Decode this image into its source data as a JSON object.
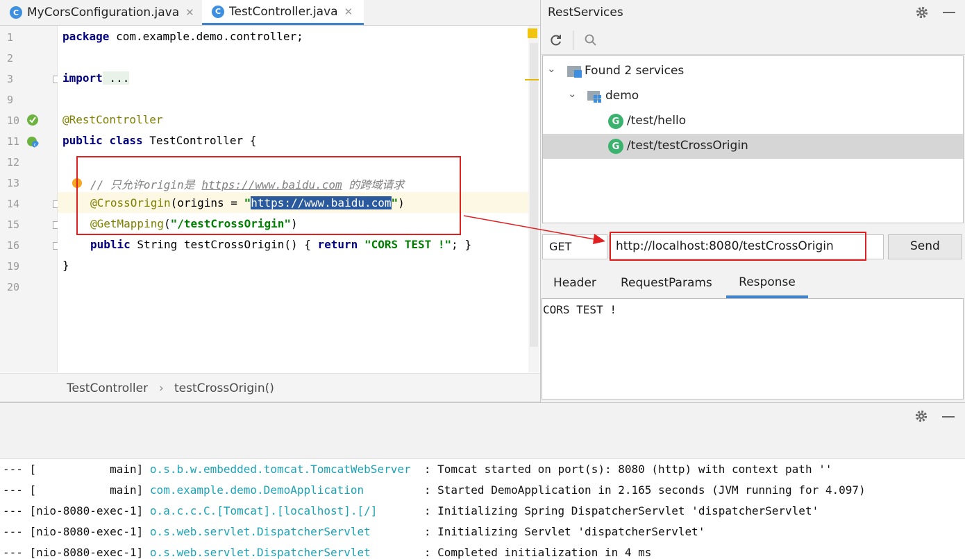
{
  "tabs": [
    {
      "label": "MyCorsConfiguration.java",
      "icon": "class-icon"
    },
    {
      "label": "TestController.java",
      "icon": "class-icon",
      "active": true
    }
  ],
  "editor": {
    "line_numbers": [
      "1",
      "2",
      "3",
      "9",
      "10",
      "11",
      "12",
      "13",
      "14",
      "15",
      "16",
      "19",
      "20"
    ],
    "lines": {
      "l1_kw": "package",
      "l1_rest": " com.example.demo.controller;",
      "l3_kw": "import",
      "l3_rest": " ...",
      "l10": "@RestController",
      "l11_kw1": "public",
      "l11_kw2": "class",
      "l11_rest": " TestController {",
      "l13_comment_a": "// 只允许origin是 ",
      "l13_link": "https://www.baidu.com",
      "l13_comment_b": " 的跨域请求",
      "l14_ann": "@CrossOrigin",
      "l14_a": "(origins = ",
      "l14_q1": "\"",
      "l14_sel": "https://www.baidu.com",
      "l14_q2": "\"",
      "l14_b": ")",
      "l15_ann": "@GetMapping",
      "l15_a": "(",
      "l15_str": "\"/testCrossOrigin\"",
      "l15_b": ")",
      "l16_kw": "public",
      "l16_a": " String testCrossOrigin() { ",
      "l16_kw2": "return",
      "l16_str": " \"CORS TEST !\"",
      "l16_b": "; }",
      "l19": "}"
    }
  },
  "breadcrumb": {
    "class": "TestController",
    "separator": "›",
    "method": "testCrossOrigin()"
  },
  "rest_panel": {
    "title": "RestServices",
    "tree": {
      "root": "Found 2 services",
      "module": "demo",
      "endpoints": [
        "/test/hello",
        "/test/testCrossOrigin"
      ],
      "method_badge": "G"
    },
    "request": {
      "method": "GET",
      "url": "http://localhost:8080/testCrossOrigin",
      "send_label": "Send"
    },
    "subtabs": [
      "Header",
      "RequestParams",
      "Response"
    ],
    "active_subtab": "Response",
    "response_body": "CORS TEST !"
  },
  "console": {
    "lines": [
      {
        "prefix": "--- [           main] ",
        "logger": "o.s.b.w.embedded.tomcat.TomcatWebServer ",
        "msg": " : Tomcat started on port(s): 8080 (http) with context path ''"
      },
      {
        "prefix": "--- [           main] ",
        "logger": "com.example.demo.DemoApplication        ",
        "msg": " : Started DemoApplication in 2.165 seconds (JVM running for 4.097)"
      },
      {
        "prefix": "--- [nio-8080-exec-1] ",
        "logger": "o.a.c.c.C.[Tomcat].[localhost].[/]      ",
        "msg": " : Initializing Spring DispatcherServlet 'dispatcherServlet'"
      },
      {
        "prefix": "--- [nio-8080-exec-1] ",
        "logger": "o.s.web.servlet.DispatcherServlet       ",
        "msg": " : Initializing Servlet 'dispatcherServlet'"
      },
      {
        "prefix": "--- [nio-8080-exec-1] ",
        "logger": "o.s.web.servlet.DispatcherServlet       ",
        "msg": " : Completed initialization in 4 ms"
      }
    ]
  },
  "colors": {
    "accent": "#4083c9",
    "annotation_red": "#e02020",
    "get_badge": "#3bb36f"
  }
}
